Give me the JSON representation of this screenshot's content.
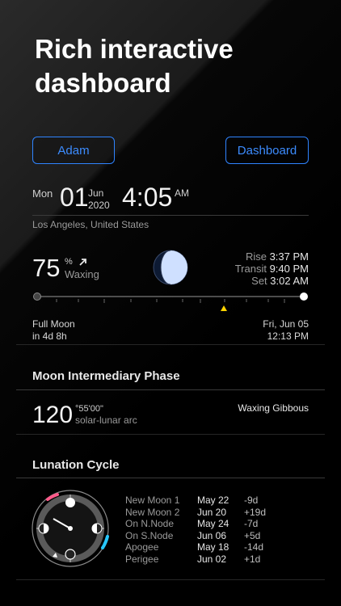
{
  "hero": {
    "title": "Rich interactive dashboard"
  },
  "buttons": {
    "left": "Adam",
    "right": "Dashboard"
  },
  "date": {
    "day": "Mon",
    "num": "01",
    "month": "Jun",
    "year": "2020",
    "time": "4:05",
    "ampm": "AM"
  },
  "location": "Los Angeles, United States",
  "illumination": {
    "value": "75",
    "unit": "%",
    "trend_icon": "arrow-up-right-icon",
    "label": "Waxing"
  },
  "moon_times": [
    {
      "key": "Rise",
      "value": "3:37 PM"
    },
    {
      "key": "Transit",
      "value": "9:40 PM"
    },
    {
      "key": "Set",
      "value": "3:02 AM"
    }
  ],
  "full_moon": {
    "line1": "Full Moon",
    "line2": "in 4d 8h",
    "date": "Fri, Jun 05",
    "time": "12:13 PM"
  },
  "intermediary": {
    "title": "Moon Intermediary Phase",
    "arc": "120",
    "arc_minutes": "°55'00\"",
    "arc_label": "solar-lunar arc",
    "phase": "Waxing Gibbous"
  },
  "lunation": {
    "title": "Lunation Cycle",
    "events": [
      {
        "name": "New Moon 1",
        "date": "May 22",
        "delta": "-9d"
      },
      {
        "name": "New Moon 2",
        "date": "Jun 20",
        "delta": "+19d"
      },
      {
        "name": "On N.Node",
        "date": "May 24",
        "delta": "-7d"
      },
      {
        "name": "On S.Node",
        "date": "Jun 06",
        "delta": "+5d"
      },
      {
        "name": "Apogee",
        "date": "May 18",
        "delta": "-14d"
      },
      {
        "name": "Perigee",
        "date": "Jun 02",
        "delta": "+1d"
      }
    ]
  },
  "colors": {
    "accent": "#2f84ff",
    "moonlight": "#cfe0ff",
    "marker": "#ffd400",
    "pink": "#ff5a8a",
    "cyan": "#27c7ff"
  }
}
